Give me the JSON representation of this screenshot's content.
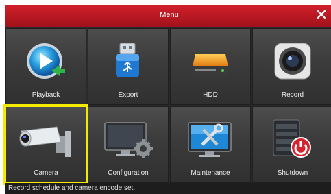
{
  "window": {
    "title": "Menu",
    "close_symbol": "✕"
  },
  "menu": {
    "items": [
      {
        "label": "Playback",
        "icon": "playback-icon"
      },
      {
        "label": "Export",
        "icon": "usb-drive-icon"
      },
      {
        "label": "HDD",
        "icon": "hard-drive-icon"
      },
      {
        "label": "Record",
        "icon": "camera-lens-icon"
      },
      {
        "label": "Camera",
        "icon": "security-camera-icon",
        "selected": true
      },
      {
        "label": "Configuration",
        "icon": "monitor-gear-icon"
      },
      {
        "label": "Maintenance",
        "icon": "monitor-tools-icon"
      },
      {
        "label": "Shutdown",
        "icon": "server-power-icon"
      }
    ]
  },
  "status": {
    "text": "Record schedule and camera encode set."
  },
  "colors": {
    "titlebar": "#c3141f",
    "selection": "#f4ea00",
    "tile_background": "#3b3b3b"
  }
}
